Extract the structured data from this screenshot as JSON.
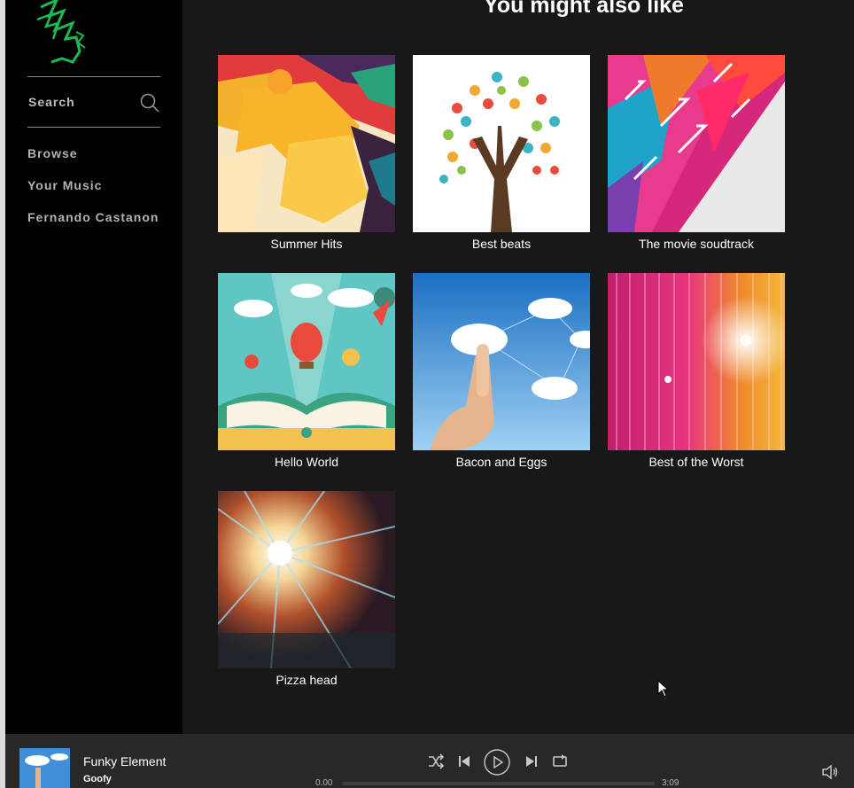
{
  "sidebar": {
    "search_label": "Search",
    "nav": [
      "Browse",
      "Your Music",
      "Fernando Castanon"
    ]
  },
  "main": {
    "heading": "You might also like",
    "playlists": [
      {
        "title": "Summer Hits",
        "art": "summer-hits-art"
      },
      {
        "title": "Best beats",
        "art": "best-beats-art"
      },
      {
        "title": "The movie soudtrack",
        "art": "movie-soundtrack-art"
      },
      {
        "title": "Hello World",
        "art": "hello-world-art"
      },
      {
        "title": "Bacon and Eggs",
        "art": "bacon-and-eggs-art"
      },
      {
        "title": "Best of the Worst",
        "art": "best-of-the-worst-art"
      },
      {
        "title": "Pizza head",
        "art": "pizza-head-art"
      }
    ]
  },
  "player": {
    "track_title": "Funky Element",
    "track_artist": "Goofy",
    "time_current": "0.00",
    "time_total": "3:09",
    "progress": 0
  },
  "colors": {
    "accent": "#1db954",
    "background": "#181818",
    "sidebar": "#000000",
    "player": "#282828"
  },
  "icons": [
    "logo-icon",
    "search-icon",
    "shuffle-icon",
    "previous-icon",
    "play-icon",
    "next-icon",
    "repeat-icon",
    "volume-icon"
  ]
}
